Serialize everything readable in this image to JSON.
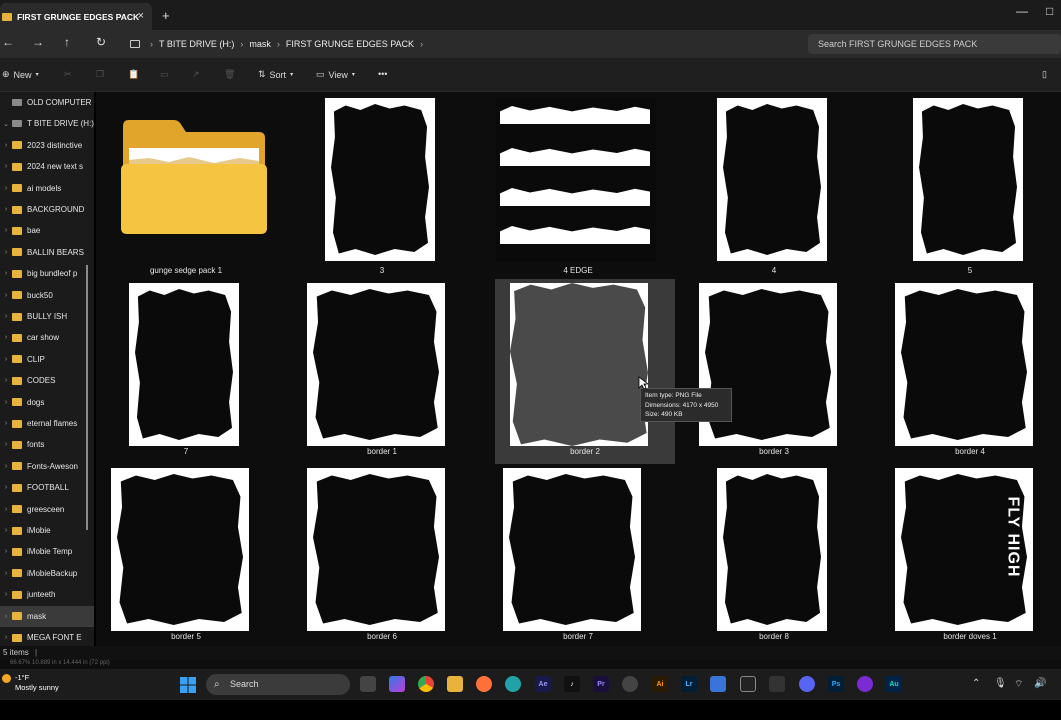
{
  "window": {
    "tab_title": "FIRST GRUNGE EDGES PACK",
    "tab_close": "×",
    "new_tab": "+",
    "minimize": "—",
    "maximize": "□"
  },
  "address": {
    "back": "←",
    "forward": "→",
    "up": "↑",
    "refresh": "↻",
    "crumbs": [
      "T BITE DRIVE (H:)",
      "mask",
      "FIRST GRUNGE EDGES PACK"
    ],
    "sep": "›",
    "search_placeholder": "Search FIRST GRUNGE EDGES PACK"
  },
  "commands": {
    "new_label": "New",
    "sort_label": "Sort",
    "view_label": "View",
    "more": "•••"
  },
  "sidebar": {
    "items": [
      {
        "label": "OLD COMPUTER",
        "type": "drive"
      },
      {
        "label": "T BITE DRIVE (H:)",
        "type": "drive",
        "expanded": true
      },
      {
        "label": "2023 distinctive",
        "type": "folder"
      },
      {
        "label": "2024 new text s",
        "type": "folder"
      },
      {
        "label": "ai models",
        "type": "folder"
      },
      {
        "label": "BACKGROUND",
        "type": "folder"
      },
      {
        "label": "bae",
        "type": "folder"
      },
      {
        "label": "BALLIN BEARS",
        "type": "folder"
      },
      {
        "label": "big bundleof p",
        "type": "folder"
      },
      {
        "label": "buck50",
        "type": "folder"
      },
      {
        "label": "BULLY ISH",
        "type": "folder"
      },
      {
        "label": "car show",
        "type": "folder"
      },
      {
        "label": "CLIP",
        "type": "folder"
      },
      {
        "label": "CODES",
        "type": "folder"
      },
      {
        "label": "dogs",
        "type": "folder"
      },
      {
        "label": "eternal flames",
        "type": "folder"
      },
      {
        "label": "fonts",
        "type": "folder"
      },
      {
        "label": "Fonts-Aweson",
        "type": "folder"
      },
      {
        "label": "FOOTBALL",
        "type": "folder"
      },
      {
        "label": "greesceen",
        "type": "folder"
      },
      {
        "label": "iMobie",
        "type": "folder"
      },
      {
        "label": "iMobie Temp",
        "type": "folder"
      },
      {
        "label": "iMobieBackup",
        "type": "folder"
      },
      {
        "label": "junteeth",
        "type": "folder"
      },
      {
        "label": "mask",
        "type": "folder",
        "active": true
      },
      {
        "label": "MEGA FONT E",
        "type": "folder"
      }
    ]
  },
  "files": [
    {
      "name": "gunge sedge pack 1",
      "kind": "folder"
    },
    {
      "name": "3",
      "kind": "frame"
    },
    {
      "name": "4 EDGE",
      "kind": "strips"
    },
    {
      "name": "4",
      "kind": "frame"
    },
    {
      "name": "5",
      "kind": "frame"
    },
    {
      "name": "7",
      "kind": "frame"
    },
    {
      "name": "border 1",
      "kind": "frame"
    },
    {
      "name": "border 2",
      "kind": "frame",
      "selected": true
    },
    {
      "name": "border 3",
      "kind": "frame"
    },
    {
      "name": "border 4",
      "kind": "frame"
    },
    {
      "name": "border 5",
      "kind": "frame"
    },
    {
      "name": "border 6",
      "kind": "frame"
    },
    {
      "name": "border 7",
      "kind": "frame"
    },
    {
      "name": "border 8",
      "kind": "frame"
    },
    {
      "name": "border doves 1",
      "kind": "frame",
      "overlay_text": "FLY HIGH"
    }
  ],
  "tooltip": {
    "line1": "Item type: PNG File",
    "line2": "Dimensions: 4170 x 4950",
    "line3": "Size: 490 KB"
  },
  "status": {
    "items": "5 items",
    "zoom_text": "66.67%   10.889 in x 14.444 in (72 ppi)"
  },
  "taskbar": {
    "temp": "-1°F",
    "weather": "Mostly sunny",
    "search_label": "Search",
    "apps": [
      "Ae",
      "Pr",
      "Ai",
      "Lr",
      "Ps",
      "Au"
    ]
  },
  "colors": {
    "folder": "#e8b33d",
    "selected_tile": "#3a3a3a",
    "background": "#0d0d0d"
  }
}
